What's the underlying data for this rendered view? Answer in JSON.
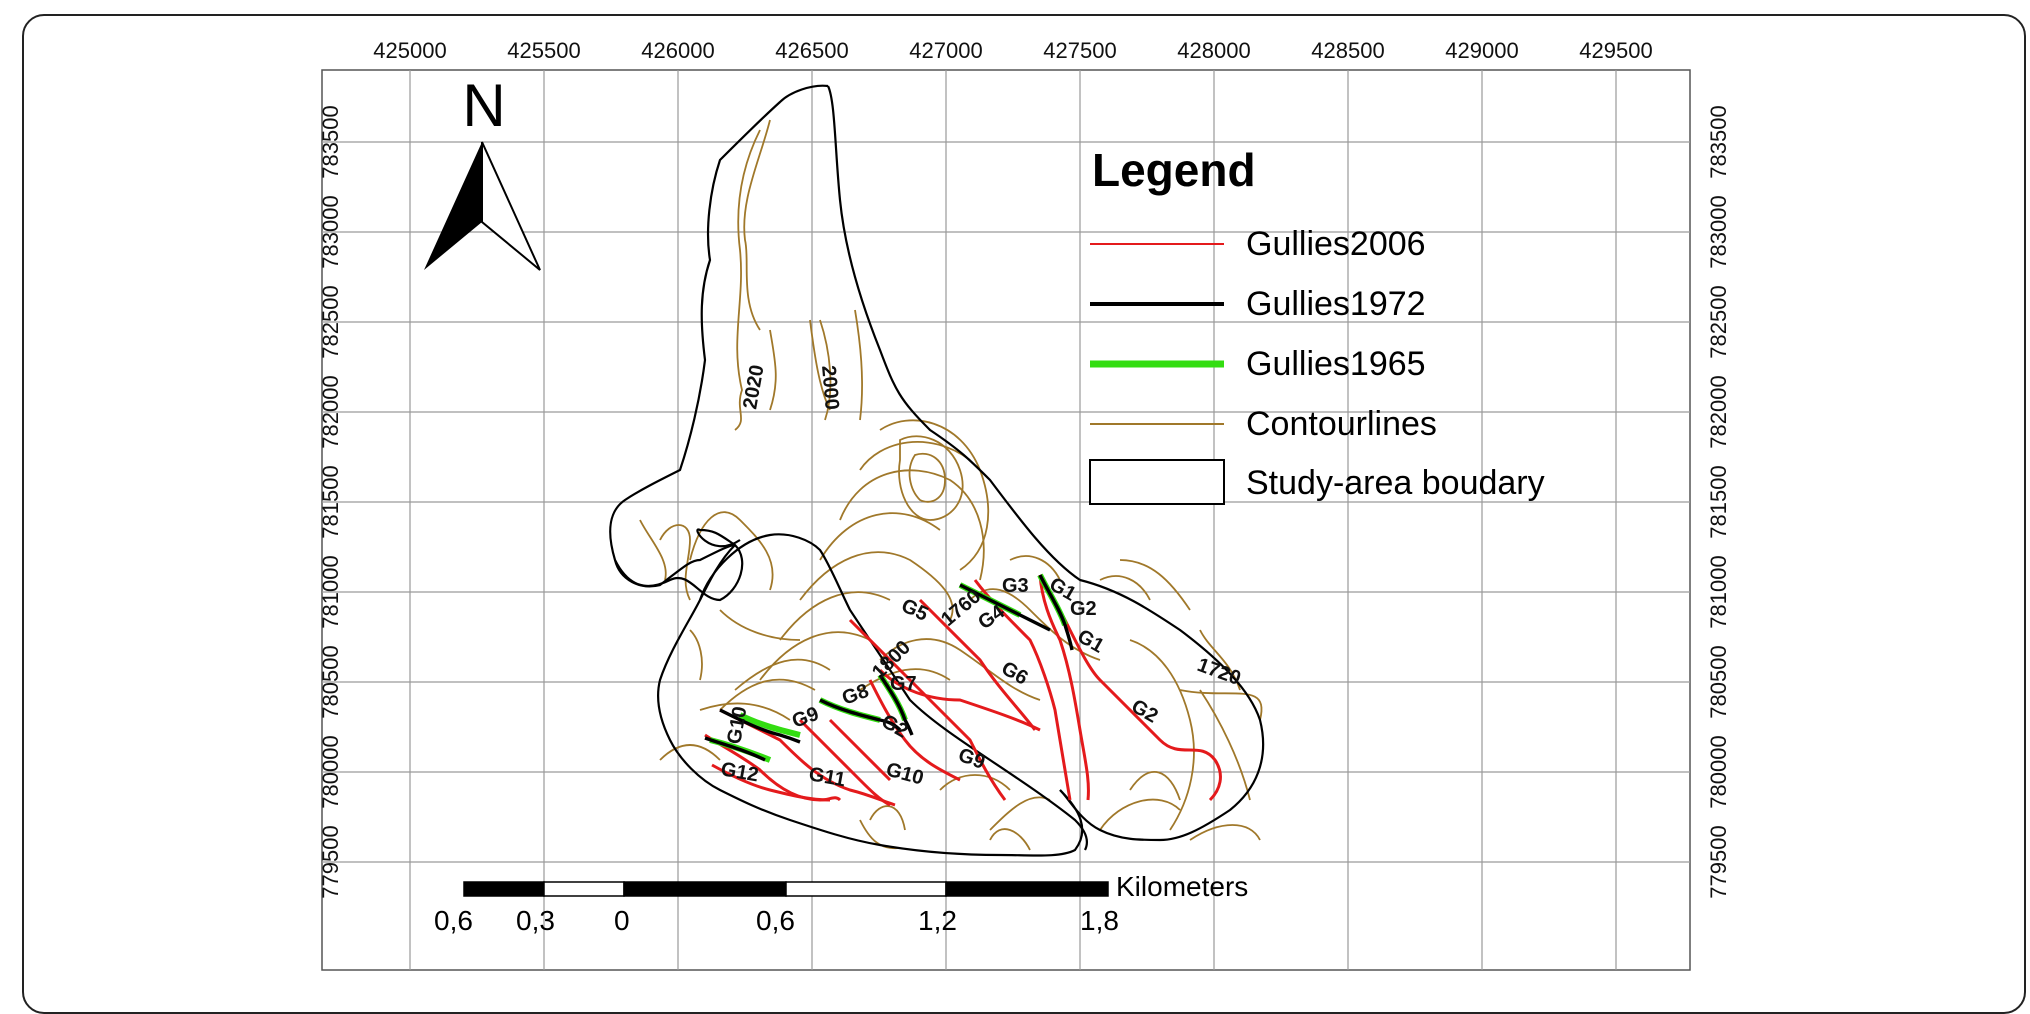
{
  "map": {
    "x_ticks": [
      "425000",
      "425500",
      "426000",
      "426500",
      "427000",
      "427500",
      "428000",
      "428500",
      "429000",
      "429500"
    ],
    "y_ticks": [
      "783500",
      "783000",
      "782500",
      "782000",
      "781500",
      "781000",
      "780500",
      "780000",
      "779500"
    ],
    "north_arrow": {
      "label": "N",
      "icon": "north-arrow-icon"
    },
    "legend": {
      "title": "Legend",
      "items": [
        {
          "label": "Gullies2006",
          "color": "#e41a1c",
          "style": "thin-line"
        },
        {
          "label": "Gullies1972",
          "color": "#000000",
          "style": "thick-line"
        },
        {
          "label": "Gullies1965",
          "color": "#33dd11",
          "style": "thick-line"
        },
        {
          "label": "Contourlines",
          "color": "#a0782a",
          "style": "thin-line"
        },
        {
          "label": "Study-area boudary",
          "color": "#000000",
          "style": "box"
        }
      ]
    },
    "contour_labels": [
      "2020",
      "2000",
      "1760",
      "1800",
      "1720"
    ],
    "gully_labels": [
      "G1",
      "G2",
      "G2",
      "G3",
      "G4",
      "G5",
      "G6",
      "G7",
      "G8",
      "G9",
      "G9",
      "G10",
      "G10",
      "G11",
      "G12",
      "G1",
      "G2"
    ],
    "scale_bar": {
      "unit": "Kilometers",
      "labels": [
        "0,6",
        "0,3",
        "0",
        "0,6",
        "1,2",
        "1,8"
      ]
    },
    "colors": {
      "gullies2006": "#e41a1c",
      "gullies1972": "#000000",
      "gullies1965": "#33dd11",
      "contour": "#a0782a",
      "grid": "#9a9a9a"
    }
  }
}
